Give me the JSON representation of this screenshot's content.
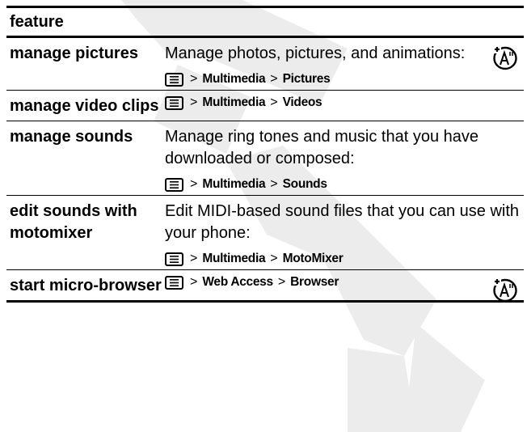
{
  "table": {
    "header": "feature",
    "rows": [
      {
        "feature": "manage pictures",
        "description": "Manage photos, pictures, and animations:",
        "path": [
          "Multimedia",
          "Pictures"
        ],
        "has_network_icon": true
      },
      {
        "feature": "manage video clips",
        "description": "",
        "path": [
          "Multimedia",
          "Videos"
        ],
        "has_network_icon": false
      },
      {
        "feature": "manage sounds",
        "description": "Manage ring tones and music that you have downloaded or composed:",
        "path": [
          "Multimedia",
          "Sounds"
        ],
        "has_network_icon": false
      },
      {
        "feature": "edit sounds with motomixer",
        "description": "Edit MIDI-based sound files that you can use with your phone:",
        "path": [
          "Multimedia",
          "MotoMixer"
        ],
        "has_network_icon": false
      },
      {
        "feature": "start micro-browser",
        "description": "",
        "path": [
          "Web Access",
          "Browser"
        ],
        "has_network_icon": true
      }
    ]
  },
  "separator": ">",
  "icons": {
    "menu_key": "menu-key-icon",
    "network": "network-dependent-icon"
  },
  "colors": {
    "watermark": "#e8e8e8",
    "rule": "#000000"
  }
}
